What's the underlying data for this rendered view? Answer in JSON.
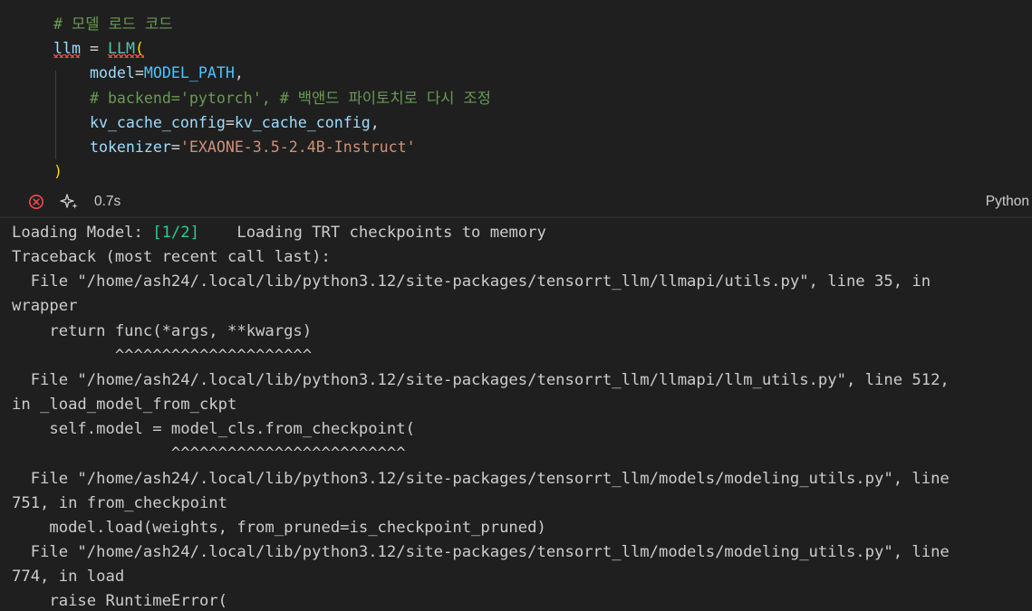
{
  "cell": {
    "code_lines": [
      [
        {
          "t": "# 모델 로드 코드",
          "c": "comment"
        }
      ],
      [
        {
          "t": "llm",
          "c": "var",
          "squiggle": true
        },
        {
          "t": " = ",
          "c": "op"
        },
        {
          "t": "LLM",
          "c": "class",
          "squiggle": true
        },
        {
          "t": "(",
          "c": "paren",
          "squiggle": true
        }
      ],
      [
        {
          "t": "    model",
          "c": "var"
        },
        {
          "t": "=",
          "c": "op"
        },
        {
          "t": "MODEL_PATH",
          "c": "const"
        },
        {
          "t": ",",
          "c": "op"
        }
      ],
      [
        {
          "t": "    # backend='pytorch', # 백앤드 파이토치로 다시 조정",
          "c": "comment"
        }
      ],
      [
        {
          "t": "    kv_cache_config",
          "c": "var"
        },
        {
          "t": "=",
          "c": "op"
        },
        {
          "t": "kv_cache_config",
          "c": "var"
        },
        {
          "t": ",",
          "c": "op"
        }
      ],
      [
        {
          "t": "    tokenizer",
          "c": "var"
        },
        {
          "t": "=",
          "c": "op"
        },
        {
          "t": "'EXAONE-3.5-2.4B-Instruct'",
          "c": "str"
        }
      ],
      [
        {
          "t": ")",
          "c": "paren"
        }
      ]
    ]
  },
  "status": {
    "error_icon": "error-circle-icon",
    "sparkle_icon": "sparkle-icon",
    "exec_time": "0.7s",
    "language": "Python"
  },
  "output": {
    "lines": [
      [
        {
          "t": "Loading Model: "
        },
        {
          "t": "[1/2]",
          "c": "green"
        },
        {
          "t": "    Loading TRT checkpoints to memory"
        }
      ],
      [
        {
          "t": "Traceback (most recent call last):"
        }
      ],
      [
        {
          "t": "  File \"/home/ash24/.local/lib/python3.12/site-packages/tensorrt_llm/llmapi/utils.py\", line 35, in"
        }
      ],
      [
        {
          "t": "wrapper"
        }
      ],
      [
        {
          "t": "    return func(*args, **kwargs)"
        }
      ],
      [
        {
          "t": "           ^^^^^^^^^^^^^^^^^^^^^"
        }
      ],
      [
        {
          "t": "  File \"/home/ash24/.local/lib/python3.12/site-packages/tensorrt_llm/llmapi/llm_utils.py\", line 512,"
        }
      ],
      [
        {
          "t": "in _load_model_from_ckpt"
        }
      ],
      [
        {
          "t": "    self.model = model_cls.from_checkpoint("
        }
      ],
      [
        {
          "t": "                 ^^^^^^^^^^^^^^^^^^^^^^^^^"
        }
      ],
      [
        {
          "t": "  File \"/home/ash24/.local/lib/python3.12/site-packages/tensorrt_llm/models/modeling_utils.py\", line"
        }
      ],
      [
        {
          "t": "751, in from_checkpoint"
        }
      ],
      [
        {
          "t": "    model.load(weights, from_pruned=is_checkpoint_pruned)"
        }
      ],
      [
        {
          "t": "  File \"/home/ash24/.local/lib/python3.12/site-packages/tensorrt_llm/models/modeling_utils.py\", line"
        }
      ],
      [
        {
          "t": "774, in load"
        }
      ],
      [
        {
          "t": "    raise RuntimeError("
        }
      ]
    ]
  },
  "colors": {
    "background": "#1f1f1f",
    "comment": "#6a9955",
    "variable": "#9cdcfe",
    "class": "#4ec9b0",
    "paren": "#ffd700",
    "constant": "#4fc1ff",
    "string": "#ce9178",
    "output_text": "#cccccc",
    "output_green": "#23d18b",
    "error_red": "#f14c4c"
  }
}
